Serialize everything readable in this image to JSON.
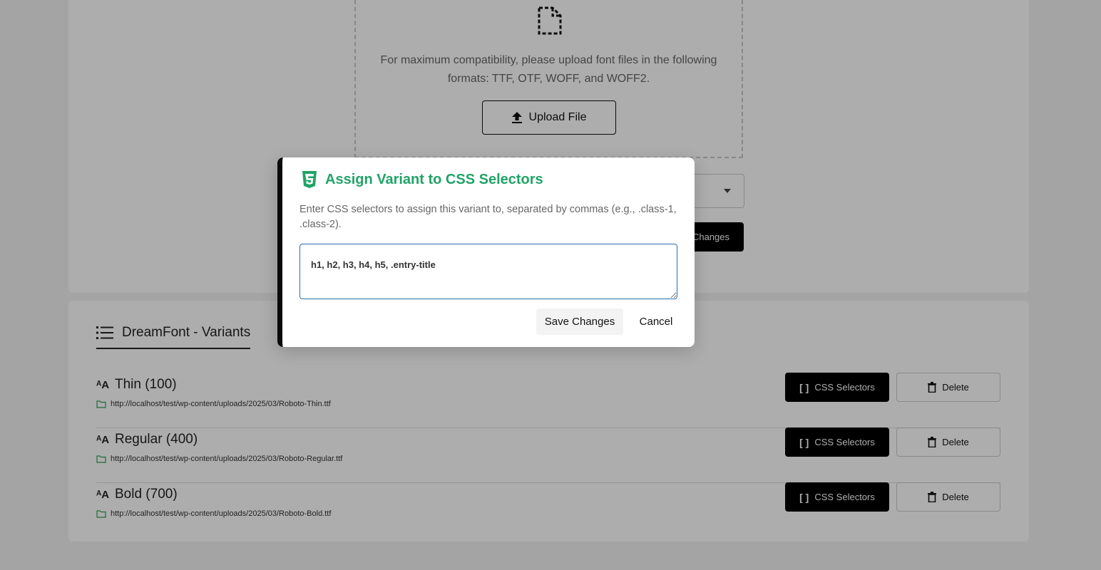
{
  "upload": {
    "hint": "For maximum compatibility, please upload font files in the following formats: TTF, OTF, WOFF, and WOFF2.",
    "upload_button": "Upload File",
    "save_button_partial": "Changes"
  },
  "variants": {
    "title": "DreamFont - Variants",
    "items": [
      {
        "name": "Thin (100)",
        "url": "http://localhost/test/wp-content/uploads/2025/03/Roboto-Thin.ttf"
      },
      {
        "name": "Regular (400)",
        "url": "http://localhost/test/wp-content/uploads/2025/03/Roboto-Regular.ttf"
      },
      {
        "name": "Bold (700)",
        "url": "http://localhost/test/wp-content/uploads/2025/03/Roboto-Bold.ttf"
      }
    ],
    "css_button": "CSS Selectors",
    "delete_button": "Delete"
  },
  "modal": {
    "title": "Assign Variant to CSS Selectors",
    "description": "Enter CSS selectors to assign this variant to, separated by commas (e.g., .class-1, .class-2).",
    "input_value": "h1, h2, h3, h4, h5, .entry-title",
    "save_button": "Save Changes",
    "cancel_button": "Cancel"
  },
  "colors": {
    "accent_green": "#21a366",
    "folder_icon_green": "#2e9e4f",
    "focus_blue": "#2b6cb0"
  },
  "icons": {
    "upload": "upload-arrow-icon",
    "file": "dashed-file-icon",
    "list": "list-icon",
    "font": "font-icon",
    "folder": "folder-icon",
    "brackets": "brackets-icon",
    "trash": "trash-icon",
    "css3": "css3-icon"
  }
}
